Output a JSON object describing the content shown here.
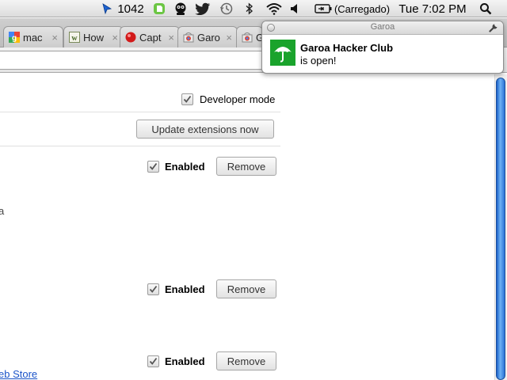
{
  "menubar": {
    "cursor_count": "1042",
    "battery_text": "(Carregado)",
    "clock": "Tue 7:02 PM",
    "icons": [
      "cursor-icon",
      "evernote-icon",
      "monster-icon",
      "twitter-icon",
      "time-machine-icon",
      "bluetooth-icon",
      "wifi-icon",
      "volume-icon",
      "battery-icon",
      "spotlight-icon"
    ]
  },
  "tabs": [
    {
      "title": "mac",
      "favicon": "google"
    },
    {
      "title": "How",
      "favicon": "wikihow"
    },
    {
      "title": "Capt",
      "favicon": "red-dot"
    },
    {
      "title": "Garo",
      "favicon": "chrome-store"
    },
    {
      "title": "Ga",
      "favicon": "chrome-store"
    }
  ],
  "tab_close_glyph": "×",
  "extensions_page": {
    "developer_mode_label": "Developer mode",
    "update_button_label": "Update extensions now",
    "extensions": [
      {
        "enabled_label": "Enabled",
        "remove_label": "Remove",
        "enabled": true
      },
      {
        "enabled_label": "Enabled",
        "remove_label": "Remove",
        "enabled": true
      },
      {
        "enabled_label": "Enabled",
        "remove_label": "Remove",
        "enabled": true
      }
    ],
    "stray_text": "a",
    "web_store_link": "eb Store"
  },
  "notification": {
    "app_name": "Garoa",
    "title": "Garoa Hacker Club",
    "body": "is open!",
    "icon": "umbrella-icon",
    "icon_bg": "#1aa32c"
  },
  "colors": {
    "scrollbar_accent": "#2a72d6",
    "link": "#1a53c8"
  }
}
